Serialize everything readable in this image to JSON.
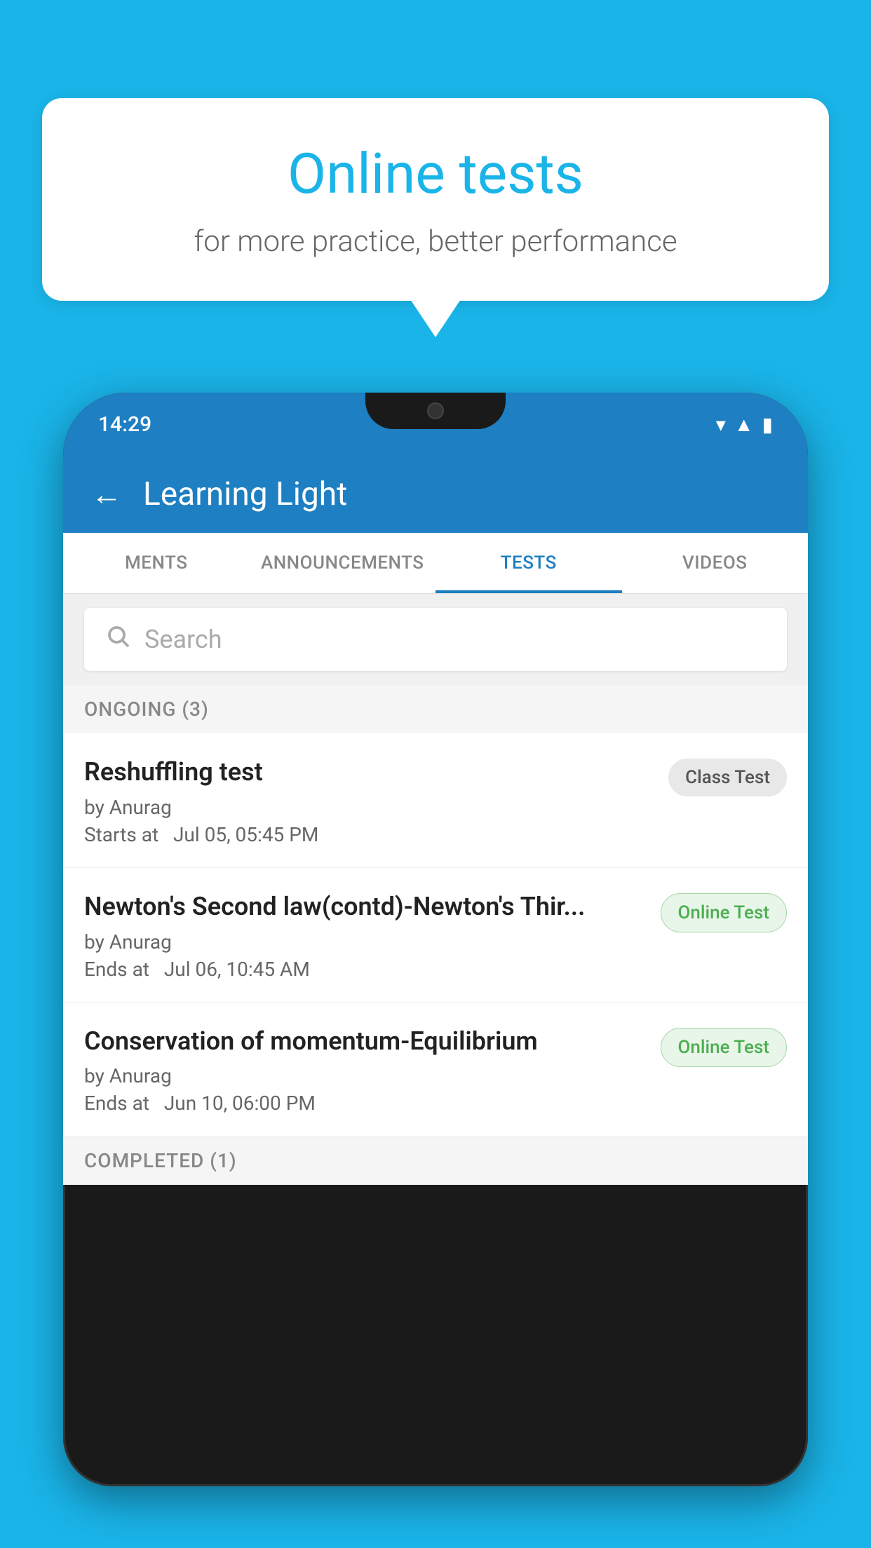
{
  "background_color": "#1ab4e8",
  "speech_bubble": {
    "title": "Online tests",
    "subtitle": "for more practice, better performance"
  },
  "phone": {
    "status_bar": {
      "time": "14:29",
      "icons": [
        "wifi",
        "signal",
        "battery"
      ]
    },
    "app_header": {
      "title": "Learning Light",
      "back_label": "←"
    },
    "tabs": [
      {
        "label": "MENTS",
        "active": false
      },
      {
        "label": "ANNOUNCEMENTS",
        "active": false
      },
      {
        "label": "TESTS",
        "active": true
      },
      {
        "label": "VIDEOS",
        "active": false
      }
    ],
    "search": {
      "placeholder": "Search"
    },
    "ongoing_section": {
      "title": "ONGOING (3)"
    },
    "tests": [
      {
        "name": "Reshuffling test",
        "author": "by Anurag",
        "time_label": "Starts at",
        "time_value": "Jul 05, 05:45 PM",
        "badge": "Class Test",
        "badge_type": "class"
      },
      {
        "name": "Newton's Second law(contd)-Newton's Thir...",
        "author": "by Anurag",
        "time_label": "Ends at",
        "time_value": "Jul 06, 10:45 AM",
        "badge": "Online Test",
        "badge_type": "online"
      },
      {
        "name": "Conservation of momentum-Equilibrium",
        "author": "by Anurag",
        "time_label": "Ends at",
        "time_value": "Jun 10, 06:00 PM",
        "badge": "Online Test",
        "badge_type": "online"
      }
    ],
    "completed_section": {
      "title": "COMPLETED (1)"
    }
  }
}
